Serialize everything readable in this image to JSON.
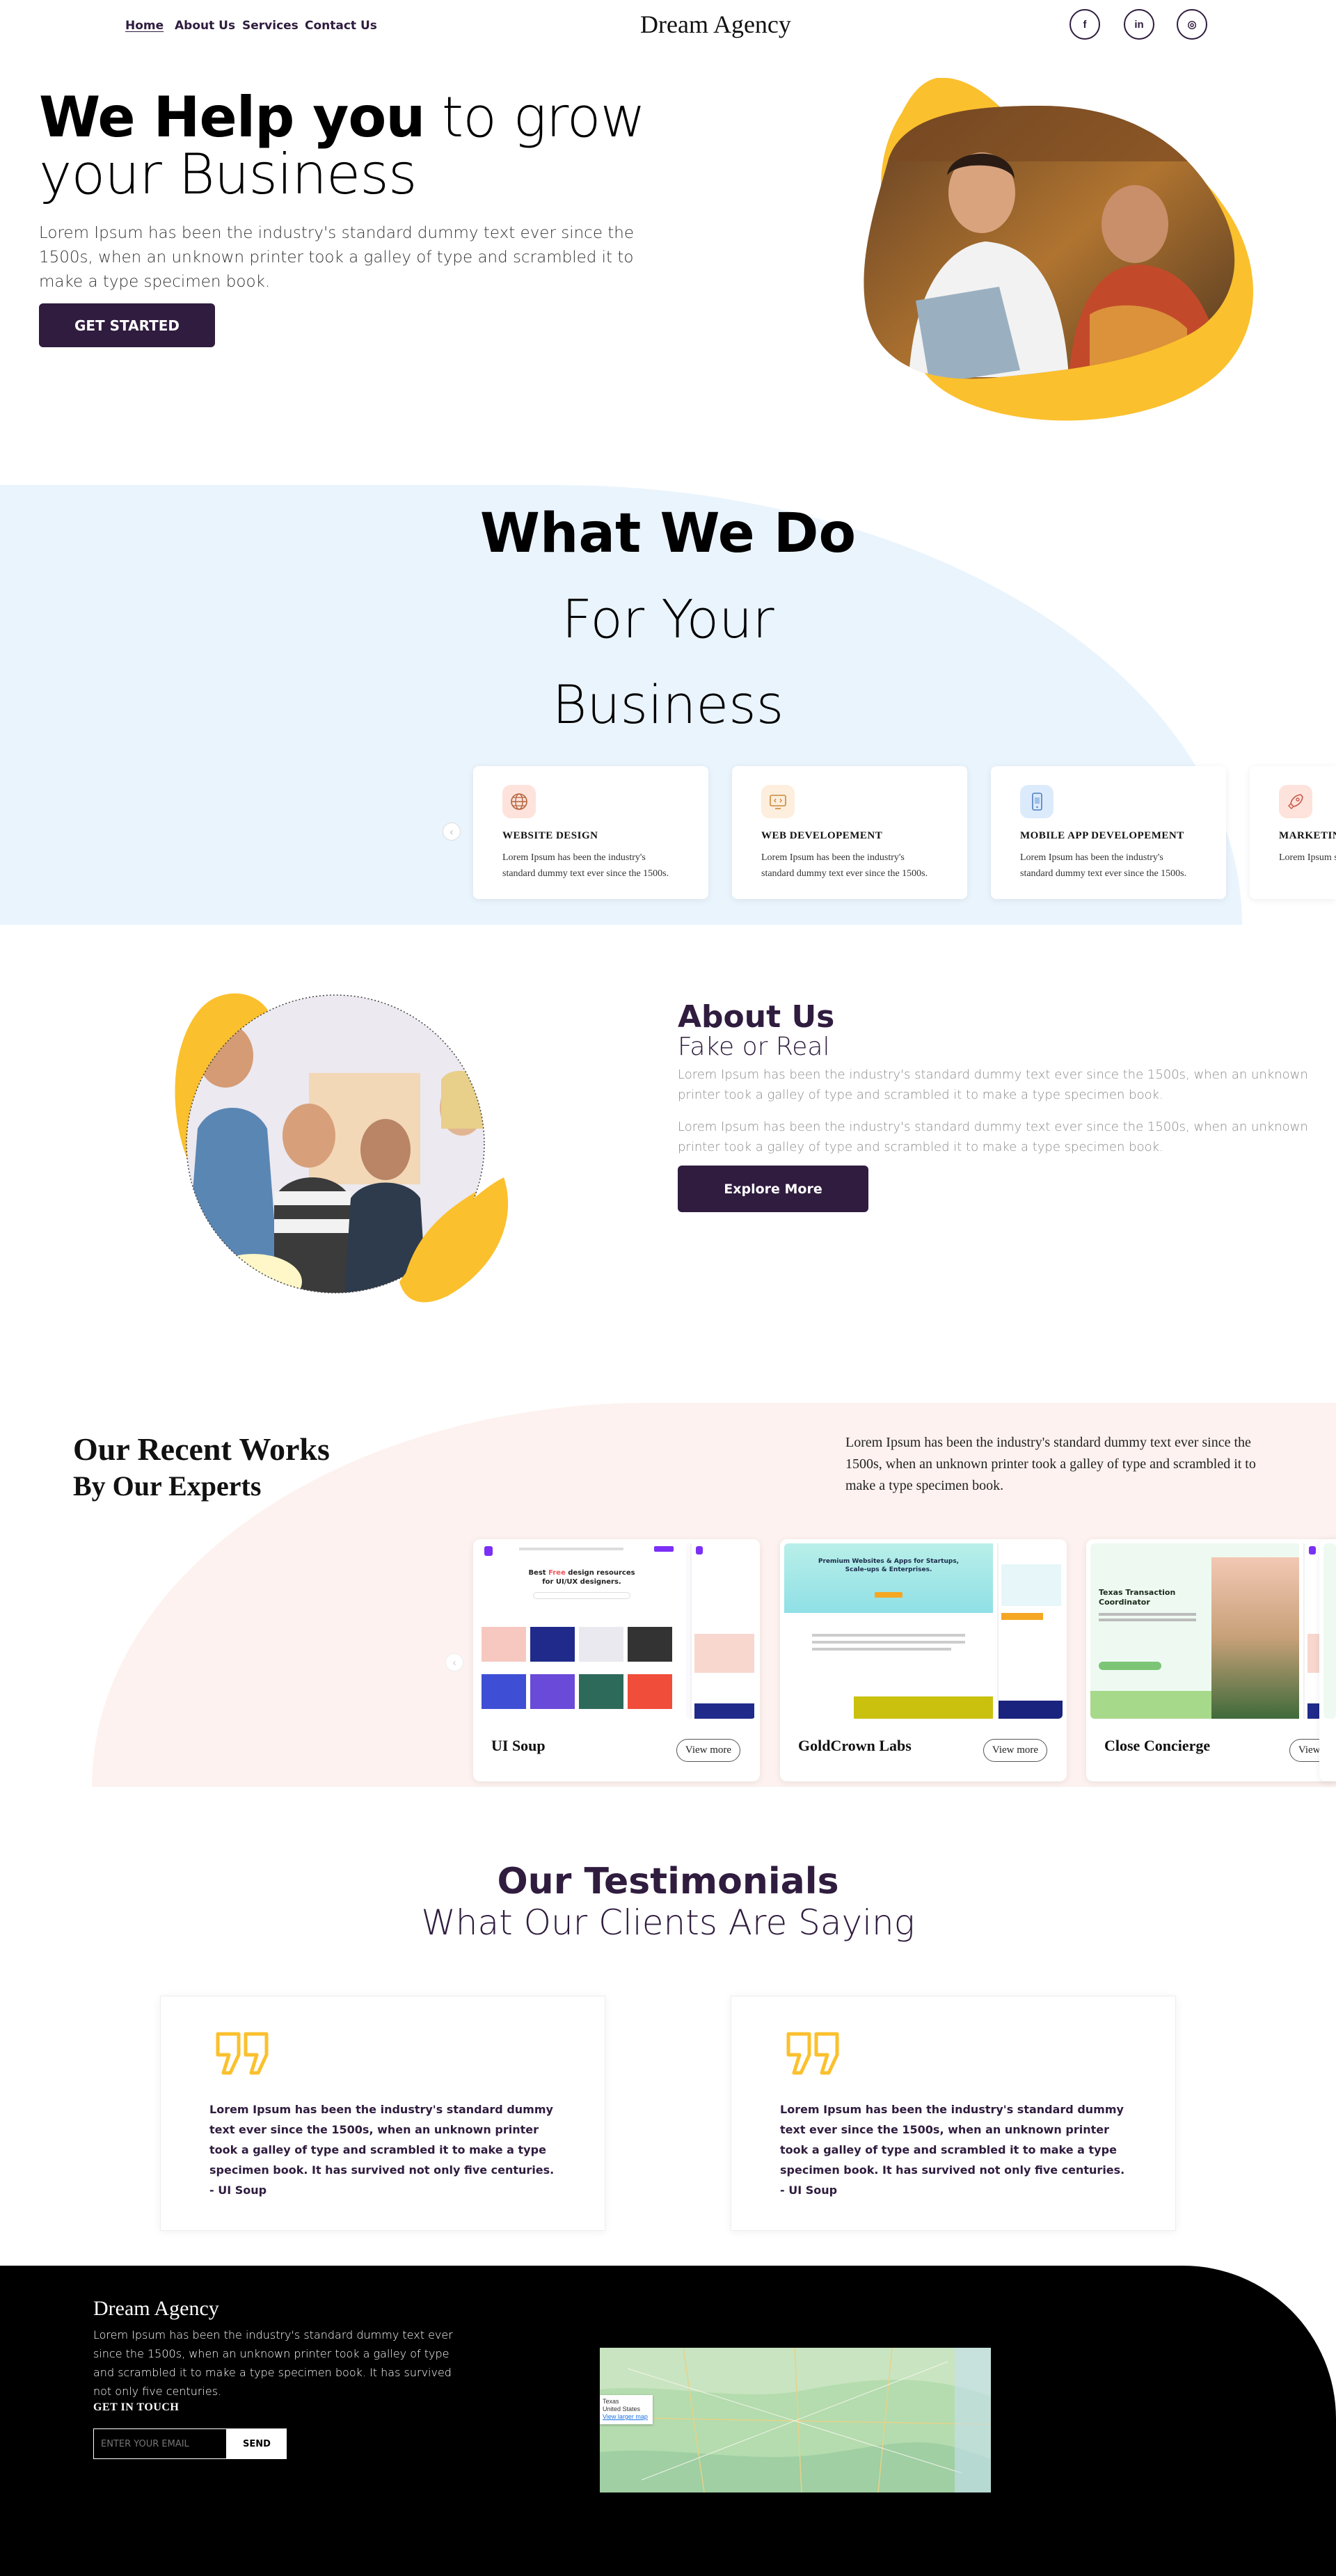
{
  "nav": {
    "links": [
      {
        "label": "Home",
        "active": true
      },
      {
        "label": "About Us"
      },
      {
        "label": "Services"
      },
      {
        "label": "Contact Us"
      }
    ],
    "brand": "Dream Agency",
    "social": [
      {
        "icon": "facebook-icon",
        "glyph": "f"
      },
      {
        "icon": "linkedin-icon",
        "glyph": "in"
      },
      {
        "icon": "instagram-icon",
        "glyph": "◎"
      }
    ]
  },
  "hero": {
    "title_bold": "We Help you",
    "title_rest1": " to grow",
    "title_line2": "your Business",
    "text": "Lorem Ipsum has been the industry's standard dummy text ever since the 1500s, when an unknown printer took a galley of type and scrambled it to make a type specimen book.",
    "cta": "GET STARTED"
  },
  "what_we_do": {
    "title": "What We Do",
    "subtitle_line1": "For Your",
    "subtitle_line2": "Business",
    "cards": [
      {
        "title": "WEBSITE DESIGN",
        "desc": "Lorem Ipsum has been the industry's standard dummy text ever since the 1500s.",
        "icon": "globe-icon",
        "color": "#fde3dc"
      },
      {
        "title": "WEB DEVELOPEMENT",
        "desc": "Lorem Ipsum has been the industry's standard dummy text ever since the 1500s.",
        "icon": "monitor-code-icon",
        "color": "#fdeedd"
      },
      {
        "title": "MOBILE APP DEVELOPEMENT",
        "desc": "Lorem Ipsum has been the industry's standard dummy text ever since the 1500s.",
        "icon": "mobile-icon",
        "color": "#dcebfb"
      },
      {
        "title": "MARKETIN",
        "desc": "Lorem Ipsum standard dum",
        "icon": "rocket-icon",
        "color": "#fde3dc"
      }
    ]
  },
  "about": {
    "title": "About Us",
    "subtitle": "Fake or Real",
    "para1": "Lorem Ipsum has been the industry's standard dummy text ever since the 1500s, when an unknown printer took a galley of type and scrambled it to make a type specimen book.",
    "para2": "Lorem Ipsum has been the industry's standard dummy text ever since the 1500s, when an unknown printer took a galley of type and scrambled it to make a type specimen book.",
    "cta": "Explore More"
  },
  "works": {
    "title": "Our Recent Works",
    "subtitle": "By Our Experts",
    "text": "Lorem Ipsum has been the industry's standard dummy text ever since the 1500s, when an unknown printer took a galley of type and scrambled it to make a type specimen book.",
    "view_more": "View more",
    "cards": [
      {
        "title": "UI Soup",
        "thumb_headline_a": "Best ",
        "thumb_headline_b": "Free",
        "thumb_headline_c": " design resources",
        "thumb_headline_d": "for UI/UX designers."
      },
      {
        "title": "GoldCrown Labs",
        "thumb_headline_a": "Premium Websites & Apps for Startups,",
        "thumb_headline_b": "Scale-ups & Enterprises."
      },
      {
        "title": "Close Concierge",
        "thumb_headline_a": "Texas Transaction",
        "thumb_headline_b": "Coordinator"
      }
    ]
  },
  "testimonials": {
    "title": "Our Testimonials",
    "subtitle": "What Our Clients Are Saying",
    "items": [
      {
        "text": "Lorem Ipsum has been the industry's standard dummy text ever since the 1500s, when an unknown printer took a galley of type and scrambled it to make a type specimen book. It has survived not only five centuries.",
        "author": "- UI Soup"
      },
      {
        "text": "Lorem Ipsum has been the industry's standard dummy text ever since the 1500s, when an unknown printer took a galley of type and scrambled it to make a type specimen book. It has survived not only five centuries.",
        "author": "- UI Soup"
      }
    ]
  },
  "footer": {
    "brand": "Dream Agency",
    "text": "Lorem Ipsum has been the industry's standard dummy text ever since the 1500s, when an unknown printer took a galley of type and scrambled it to make a type specimen book. It has survived not only five centuries.",
    "get_in_touch": "GET IN TOUCH",
    "email_placeholder": "ENTER YOUR EMAIL",
    "send": "SEND",
    "map_label_1": "Texas",
    "map_label_2": "United States",
    "map_link": "View larger map"
  },
  "colors": {
    "brand_dark": "#2f1c3e",
    "accent_yellow": "#fbc02d",
    "light_blue": "#eaf4fd",
    "light_peach": "#fdf2ef"
  }
}
